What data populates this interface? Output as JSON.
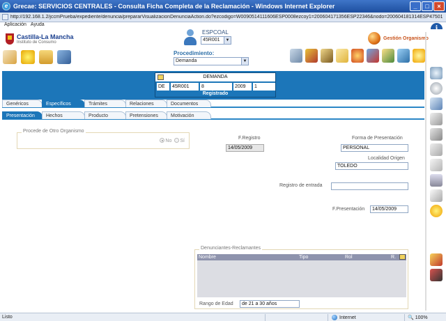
{
  "window": {
    "title": "Grecae: SERVICIOS CENTRALES - Consulta Ficha Completa de la Reclamación - Windows Internet Explorer",
    "buttons": [
      "_",
      "□",
      "×"
    ]
  },
  "address": {
    "url": "http://192.168.1.2/jccmPrueba/expediente/denuncia/prepararVisualizacionDenunciaAction.do?ezcodigo=W0090514111606ESP0008ezcoy1=200604171356ESP22346&nodo=200604181314ESP47501"
  },
  "menu": {
    "items": [
      "Aplicación",
      "Ayuda"
    ]
  },
  "header": {
    "logo_name": "Castilla-La Mancha",
    "logo_sub": "Instituto de Consumo",
    "user_label": "ESPCOAL",
    "user_select": "45R001",
    "org_label": "Gestión Organismo",
    "procedimiento_label": "Procedimiento:",
    "procedimiento_value": "Demanda"
  },
  "demanda": {
    "title": "DEMANDA",
    "cells": [
      "DE",
      "45R001",
      "8",
      "2009",
      "1"
    ],
    "status": "Registrado"
  },
  "tabs_primary": [
    {
      "label": "Genéricos",
      "active": false
    },
    {
      "label": "Específicos",
      "active": true
    },
    {
      "label": "Trámites",
      "active": false
    },
    {
      "label": "Relaciones",
      "active": false
    },
    {
      "label": "Documentos",
      "active": false
    }
  ],
  "tabs_secondary": [
    {
      "label": "Presentación",
      "active": true
    },
    {
      "label": "Hechos",
      "active": false
    },
    {
      "label": "Producto",
      "active": false
    },
    {
      "label": "Pretensiones",
      "active": false
    },
    {
      "label": "Motivación",
      "active": false
    }
  ],
  "form": {
    "procede_legend": "Procede de Otro Organismo",
    "radio_no": "No",
    "radio_si": "Sí",
    "fregistro_label": "F.Registro",
    "fregistro_value": "14/05/2009",
    "forma_label": "Forma de Presentación",
    "forma_value": "PERSONAL",
    "localidad_label": "Localidad Origen",
    "localidad_value": "TOLEDO",
    "registro_entrada_label": "Registro de entrada",
    "registro_entrada_value": "",
    "fpresentacion_label": "F.Presentación",
    "fpresentacion_value": "14/05/2009"
  },
  "denunciantes": {
    "legend": "Denunciantes-Reclamantes",
    "columns": [
      "Nombre",
      "Tipo",
      "Rol",
      "R."
    ],
    "rango_label": "Rango de Edad",
    "rango_value": "de 21 a 30 años"
  },
  "statusbar": {
    "text": "Listo",
    "zone": "Internet",
    "zoom": "100%"
  },
  "colors": {
    "accent": "#1c76b9",
    "title_bar": "#1d4f9f"
  }
}
